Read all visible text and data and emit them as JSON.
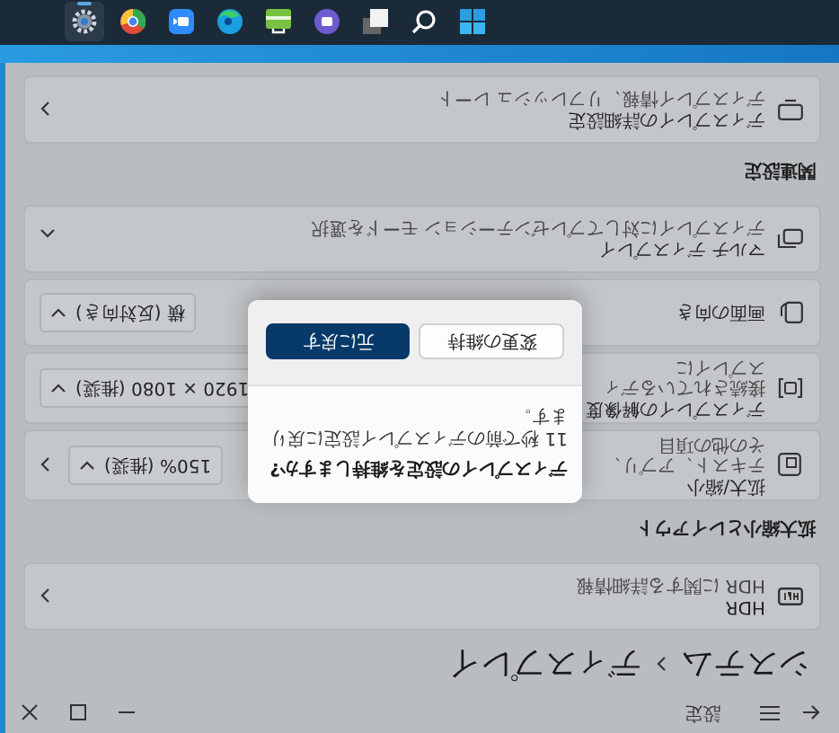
{
  "window": {
    "title": "設定"
  },
  "breadcrumb": [
    {
      "label": "システム"
    },
    {
      "label": "ディスプレイ"
    }
  ],
  "items": [
    {
      "kind": "link",
      "title": "HDR",
      "description": "HDR に関する詳細情報"
    },
    {
      "kind": "heading",
      "title": "拡大縮小とレイアウト"
    },
    {
      "kind": "dropdown-link",
      "title": "拡大/縮小",
      "description": "テキスト、アプリ、その他の項目",
      "value": "150% (推奨)"
    },
    {
      "kind": "dropdown",
      "title": "ディスプレイの解像度",
      "description": "接続されているディスプレイに",
      "value": "1920 × 1080 (推奨)"
    },
    {
      "kind": "dropdown",
      "title": "画面の向き",
      "value": "横 (反対向き)"
    },
    {
      "kind": "expander",
      "title": "マルチ ディスプレイ",
      "description": "ディスプレイに対してプレゼンテーション モードを選択",
      "expanded": true
    },
    {
      "kind": "heading",
      "title": "関連設定"
    },
    {
      "kind": "link",
      "title": "ディスプレイの詳細設定",
      "description": "ディスプレイ情報、リフレッシュ レート"
    }
  ],
  "dialog": {
    "title": "ディスプレイの設定を維持しますか?",
    "message": "11 秒で前のディスプレイ設定に戻ります。",
    "buttons": [
      {
        "label": "変更の維持",
        "primary": false
      },
      {
        "label": "元に戻す",
        "primary": true
      }
    ]
  },
  "taskbar": {
    "apps": [
      {
        "selected": false
      },
      {
        "selected": false
      },
      {
        "selected": false
      },
      {
        "selected": false
      },
      {
        "selected": false
      },
      {
        "selected": false
      },
      {
        "selected": false
      },
      {
        "selected": false
      },
      {
        "selected": true
      }
    ]
  }
}
